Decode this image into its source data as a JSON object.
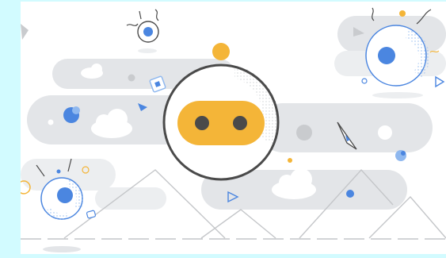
{
  "illustration": {
    "subject": "robot-face-icon",
    "colors": {
      "frame_background": "#d2fbff",
      "canvas": "#ffffff",
      "cloud": "#e3e5e8",
      "cloud_light": "#eef0f2",
      "robot_face": "#f4b538",
      "robot_eye": "#4a4a4a",
      "ring": "#4a4a4a",
      "accent_yellow": "#f4b538",
      "accent_blue": "#4b86e0",
      "accent_blue_light": "#8fb8ef",
      "accent_grey": "#c9cbce",
      "mountain_line": "#c4c6c9"
    },
    "icons": [
      "robot-face-icon",
      "planet-icon",
      "satellite-icon",
      "triangle-icon",
      "cloud-icon",
      "mountain-icon",
      "sun-icon"
    ]
  }
}
